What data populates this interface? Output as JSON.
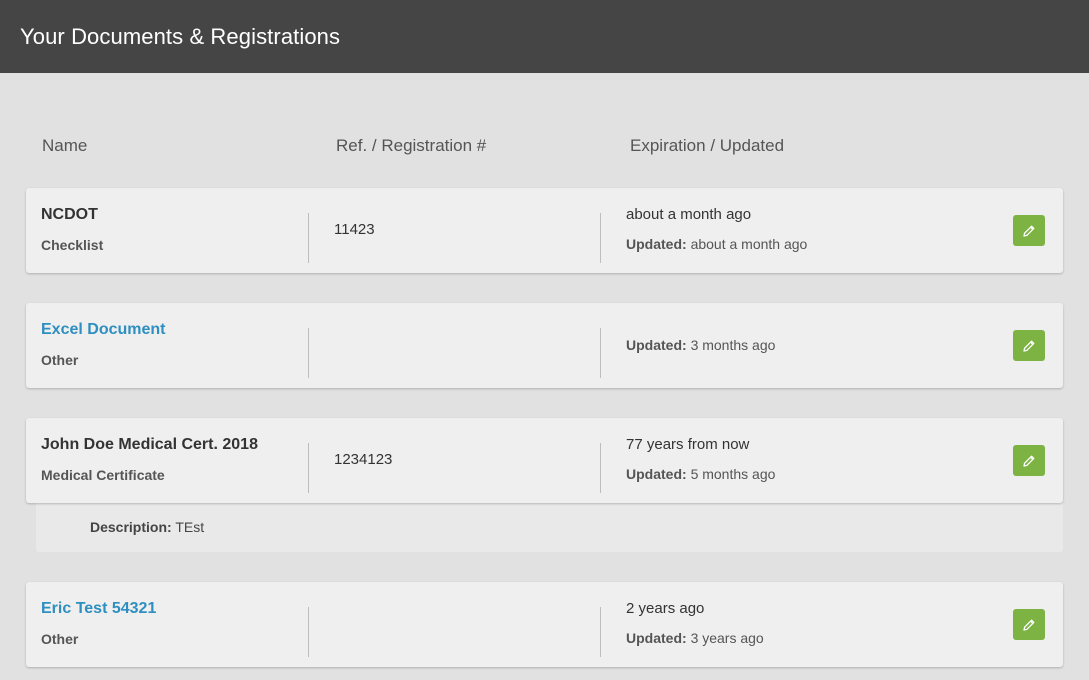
{
  "header": {
    "title": "Your Documents & Registrations"
  },
  "columns": {
    "name": "Name",
    "ref": "Ref. / Registration #",
    "expiration": "Expiration / Updated"
  },
  "updated_label": "Updated:",
  "description_label": "Description:",
  "documents": [
    {
      "title": "NCDOT",
      "type": "Checklist",
      "ref": "11423",
      "expiration": "about a month ago",
      "updated": "about a month ago",
      "title_is_link": false
    },
    {
      "title": "Excel Document",
      "type": "Other",
      "ref": "",
      "expiration": "",
      "updated": "3 months ago",
      "title_is_link": true
    },
    {
      "title": "John Doe Medical Cert. 2018",
      "type": "Medical Certificate",
      "ref": "1234123",
      "expiration": "77 years from now",
      "updated": "5 months ago",
      "title_is_link": false,
      "description": "TEst"
    },
    {
      "title": "Eric Test 54321",
      "type": "Other",
      "ref": "",
      "expiration": "2 years ago",
      "updated": "3 years ago",
      "title_is_link": true
    }
  ],
  "colors": {
    "header_bg": "#454545",
    "link": "#2e8fc0",
    "edit_button": "#7cb342"
  },
  "icons": {
    "edit": "pencil-icon"
  }
}
